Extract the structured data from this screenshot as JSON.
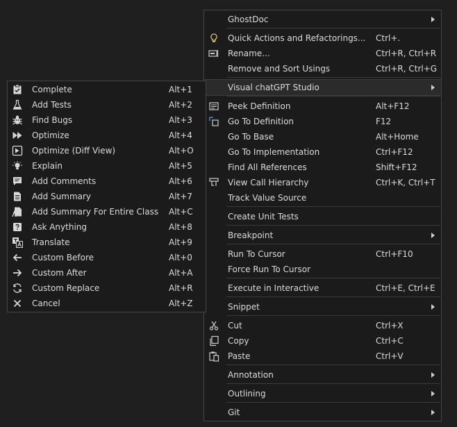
{
  "main_menu": {
    "items": [
      {
        "label": "GhostDoc",
        "shortcut": "",
        "icon": "",
        "submenu": true
      },
      {
        "label": "Quick Actions and Refactorings...",
        "shortcut": "Ctrl+.",
        "icon": "lightbulb-icon"
      },
      {
        "label": "Rename...",
        "shortcut": "Ctrl+R, Ctrl+R",
        "icon": "rename-icon"
      },
      {
        "label": "Remove and Sort Usings",
        "shortcut": "Ctrl+R, Ctrl+G",
        "icon": ""
      },
      {
        "label": "Visual chatGPT Studio",
        "shortcut": "",
        "icon": "",
        "submenu": true,
        "highlighted": true
      },
      {
        "label": "Peek Definition",
        "shortcut": "Alt+F12",
        "icon": "peek-definition-icon"
      },
      {
        "label": "Go To Definition",
        "shortcut": "F12",
        "icon": "go-to-definition-icon"
      },
      {
        "label": "Go To Base",
        "shortcut": "Alt+Home",
        "icon": ""
      },
      {
        "label": "Go To Implementation",
        "shortcut": "Ctrl+F12",
        "icon": ""
      },
      {
        "label": "Find All References",
        "shortcut": "Shift+F12",
        "icon": ""
      },
      {
        "label": "View Call Hierarchy",
        "shortcut": "Ctrl+K, Ctrl+T",
        "icon": "call-hierarchy-icon"
      },
      {
        "label": "Track Value Source",
        "shortcut": "",
        "icon": ""
      },
      {
        "label": "Create Unit Tests",
        "shortcut": "",
        "icon": ""
      },
      {
        "label": "Breakpoint",
        "shortcut": "",
        "icon": "",
        "submenu": true
      },
      {
        "label": "Run To Cursor",
        "shortcut": "Ctrl+F10",
        "icon": ""
      },
      {
        "label": "Force Run To Cursor",
        "shortcut": "",
        "icon": ""
      },
      {
        "label": "Execute in Interactive",
        "shortcut": "Ctrl+E, Ctrl+E",
        "icon": ""
      },
      {
        "label": "Snippet",
        "shortcut": "",
        "icon": "",
        "submenu": true
      },
      {
        "label": "Cut",
        "shortcut": "Ctrl+X",
        "icon": "cut-icon"
      },
      {
        "label": "Copy",
        "shortcut": "Ctrl+C",
        "icon": "copy-icon"
      },
      {
        "label": "Paste",
        "shortcut": "Ctrl+V",
        "icon": "paste-icon"
      },
      {
        "label": "Annotation",
        "shortcut": "",
        "icon": "",
        "submenu": true
      },
      {
        "label": "Outlining",
        "shortcut": "",
        "icon": "",
        "submenu": true
      },
      {
        "label": "Git",
        "shortcut": "",
        "icon": "",
        "submenu": true
      }
    ]
  },
  "sub_menu": {
    "items": [
      {
        "label": "Complete",
        "shortcut": "Alt+1",
        "icon": "clipboard-check-icon"
      },
      {
        "label": "Add Tests",
        "shortcut": "Alt+2",
        "icon": "flask-icon"
      },
      {
        "label": "Find Bugs",
        "shortcut": "Alt+3",
        "icon": "bug-icon"
      },
      {
        "label": "Optimize",
        "shortcut": "Alt+4",
        "icon": "fast-forward-icon"
      },
      {
        "label": "Optimize (Diff View)",
        "shortcut": "Alt+O",
        "icon": "diff-view-icon"
      },
      {
        "label": "Explain",
        "shortcut": "Alt+5",
        "icon": "lightbulb-icon"
      },
      {
        "label": "Add Comments",
        "shortcut": "Alt+6",
        "icon": "comment-icon"
      },
      {
        "label": "Add Summary",
        "shortcut": "Alt+7",
        "icon": "document-icon"
      },
      {
        "label": "Add Summary For Entire Class",
        "shortcut": "Alt+C",
        "icon": "class-summary-icon"
      },
      {
        "label": "Ask Anything",
        "shortcut": "Alt+8",
        "icon": "question-icon"
      },
      {
        "label": "Translate",
        "shortcut": "Alt+9",
        "icon": "translate-icon"
      },
      {
        "label": "Custom Before",
        "shortcut": "Alt+0",
        "icon": "arrow-left-icon"
      },
      {
        "label": "Custom After",
        "shortcut": "Alt+A",
        "icon": "arrow-right-icon"
      },
      {
        "label": "Custom Replace",
        "shortcut": "Alt+R",
        "icon": "replace-icon"
      },
      {
        "label": "Cancel",
        "shortcut": "Alt+Z",
        "icon": "close-icon"
      }
    ]
  }
}
